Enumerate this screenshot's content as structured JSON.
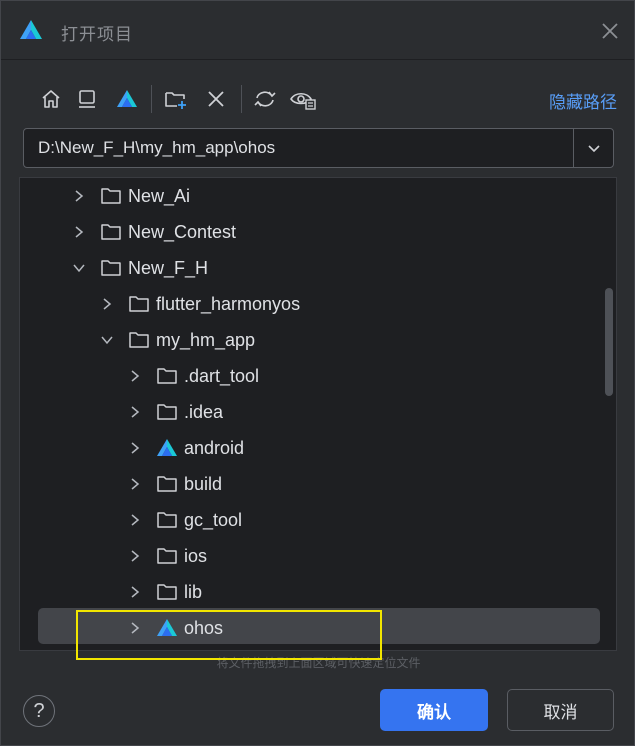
{
  "window": {
    "title": "打开项目",
    "logo_icon": "deveco-logo-icon",
    "close_icon": "close-icon"
  },
  "toolbar": {
    "buttons": [
      {
        "name": "home-icon"
      },
      {
        "name": "desktop-icon"
      },
      {
        "name": "project-icon"
      },
      {
        "name": "new-folder-icon"
      },
      {
        "name": "delete-icon"
      },
      {
        "name": "refresh-icon"
      },
      {
        "name": "show-hidden-icon"
      }
    ],
    "hide_path_label": "隐藏路径"
  },
  "path": {
    "value": "D:\\New_F_H\\my_hm_app\\ohos"
  },
  "tree": {
    "items": [
      {
        "label": "New_Ai",
        "expanded": false,
        "type": "folder"
      },
      {
        "label": "New_Contest",
        "expanded": false,
        "type": "folder"
      },
      {
        "label": "New_F_H",
        "expanded": true,
        "type": "folder"
      },
      {
        "label": "flutter_harmonyos",
        "expanded": false,
        "type": "folder"
      },
      {
        "label": "my_hm_app",
        "expanded": true,
        "type": "folder"
      },
      {
        "label": ".dart_tool",
        "expanded": false,
        "type": "folder"
      },
      {
        "label": ".idea",
        "expanded": false,
        "type": "folder"
      },
      {
        "label": "android",
        "expanded": false,
        "type": "project"
      },
      {
        "label": "build",
        "expanded": false,
        "type": "folder"
      },
      {
        "label": "gc_tool",
        "expanded": false,
        "type": "folder"
      },
      {
        "label": "ios",
        "expanded": false,
        "type": "folder"
      },
      {
        "label": "lib",
        "expanded": false,
        "type": "folder"
      },
      {
        "label": "ohos",
        "expanded": false,
        "type": "project",
        "selected": true
      }
    ]
  },
  "hint": "将文件拖拽到上面区域可快速定位文件",
  "footer": {
    "help_label": "?",
    "ok_label": "确认",
    "cancel_label": "取消"
  },
  "colors": {
    "accent": "#3574f0",
    "link": "#589df6",
    "highlight": "#f2e600",
    "logo_blue": "#3ea1f7",
    "logo_cyan": "#1bc8d6"
  }
}
